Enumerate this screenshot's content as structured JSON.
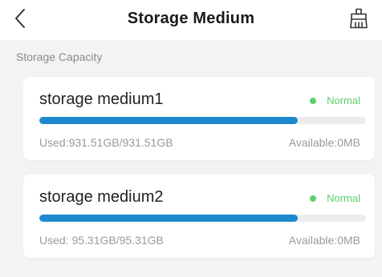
{
  "header": {
    "title": "Storage Medium",
    "back_icon": "chevron-left-icon",
    "action_icon": "format-icon"
  },
  "section": {
    "title": "Storage Capacity"
  },
  "media": [
    {
      "name": "storage medium1",
      "status": "Normal",
      "status_color": "#5fcf6a",
      "used_label": "Used:931.51GB/931.51GB",
      "available_label": "Available:0MB",
      "usage_fraction": 0.79
    },
    {
      "name": "storage medium2",
      "status": "Normal",
      "status_color": "#5fcf6a",
      "used_label": "Used: 95.31GB/95.31GB",
      "available_label": "Available:0MB",
      "usage_fraction": 0.79
    }
  ],
  "colors": {
    "accent": "#1e88cf",
    "track": "#ececec",
    "background": "#f3f3f5"
  }
}
